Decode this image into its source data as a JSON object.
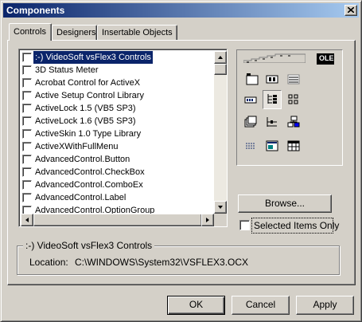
{
  "window": {
    "title": "Components"
  },
  "tabs": [
    {
      "label": "Controls"
    },
    {
      "label": "Designers"
    },
    {
      "label": "Insertable Objects"
    }
  ],
  "list": {
    "items": [
      {
        "label": ":-) VideoSoft vsFlex3 Controls",
        "checked": false,
        "selected": true
      },
      {
        "label": "3D Status Meter",
        "checked": false
      },
      {
        "label": "Acrobat Control for ActiveX",
        "checked": false
      },
      {
        "label": "Active Setup Control Library",
        "checked": false
      },
      {
        "label": "ActiveLock 1.5 (VB5 SP3)",
        "checked": false
      },
      {
        "label": "ActiveLock 1.6 (VB5 SP3)",
        "checked": false
      },
      {
        "label": "ActiveSkin 1.0 Type Library",
        "checked": false
      },
      {
        "label": "ActiveXWithFullMenu",
        "checked": false
      },
      {
        "label": "AdvancedControl.Button",
        "checked": false
      },
      {
        "label": "AdvancedControl.CheckBox",
        "checked": false
      },
      {
        "label": "AdvancedControl.ComboEx",
        "checked": false
      },
      {
        "label": "AdvancedControl.Label",
        "checked": false
      },
      {
        "label": "AdvancedControl.OptionGroup",
        "checked": false
      }
    ]
  },
  "preview": {
    "ole_label": "OLE"
  },
  "browse_label": "Browse...",
  "selected_only": {
    "label": "Selected Items Only",
    "checked": false
  },
  "group": {
    "title": ":-) VideoSoft vsFlex3 Controls",
    "location_label": "Location:",
    "location_value": "C:\\WINDOWS\\System32\\VSFLEX3.OCX"
  },
  "buttons": {
    "ok": "OK",
    "cancel": "Cancel",
    "apply": "Apply"
  },
  "colors": {
    "titlebar_start": "#0a246a",
    "titlebar_end": "#a6caf0",
    "selection": "#0a246a",
    "face": "#d4d0c8"
  }
}
